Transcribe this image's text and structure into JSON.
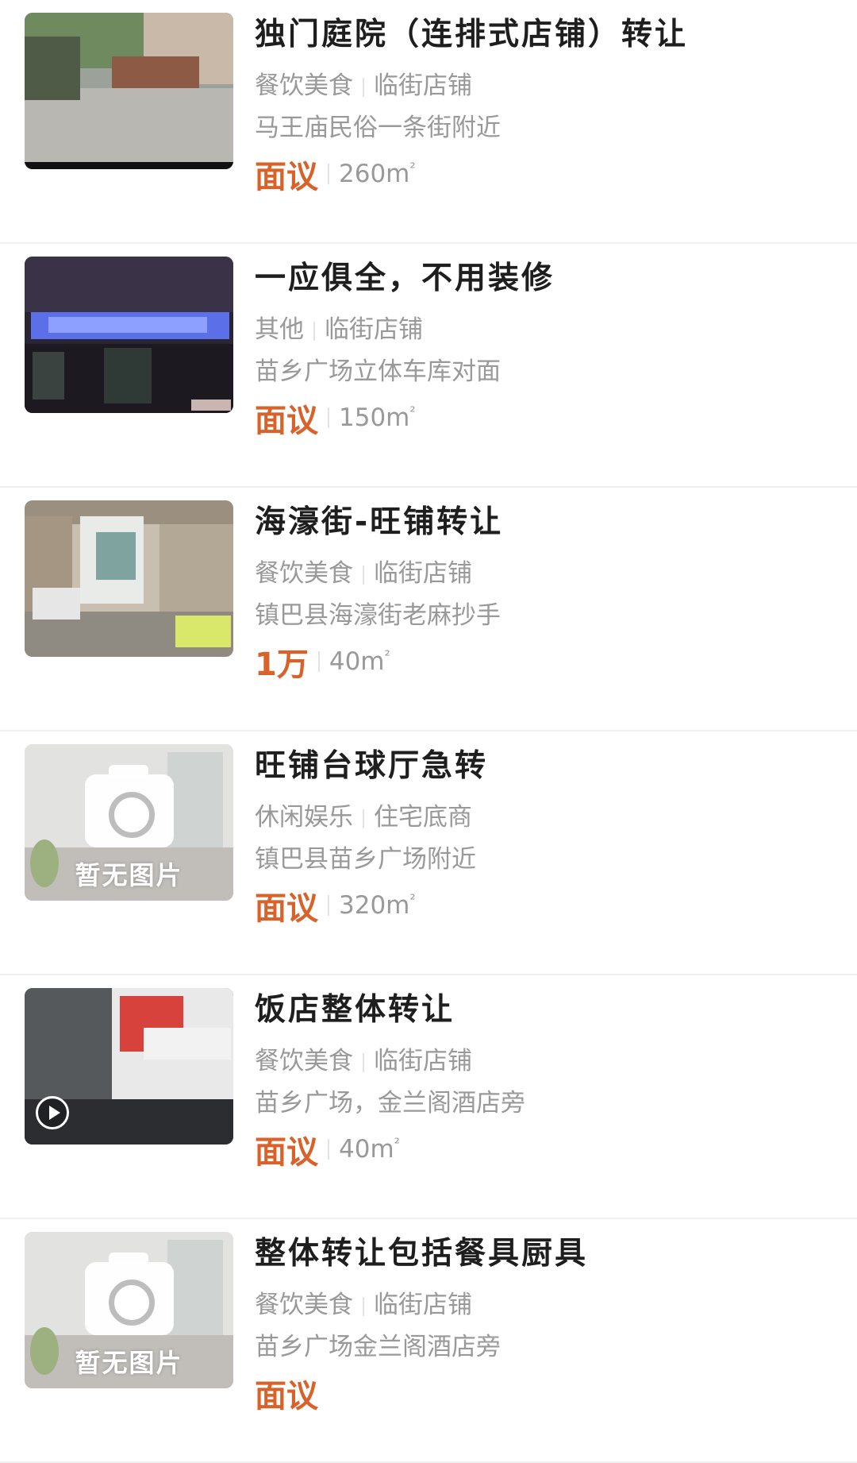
{
  "listings": [
    {
      "title": "独门庭院（连排式店铺）转让",
      "category": "餐饮美食",
      "type": "临街店铺",
      "address": "马王庙民俗一条街附近",
      "price": "面议",
      "area": "260m",
      "area_sup": "²",
      "image": "photo"
    },
    {
      "title": "一应俱全，不用装修",
      "category": "其他",
      "type": "临街店铺",
      "address": "苗乡广场立体车库对面",
      "price": "面议",
      "area": "150m",
      "area_sup": "²",
      "image": "photo"
    },
    {
      "title": "海濠街-旺铺转让",
      "category": "餐饮美食",
      "type": "临街店铺",
      "address": "镇巴县海濠街老麻抄手",
      "price": "1万",
      "area": "40m",
      "area_sup": "²",
      "image": "photo"
    },
    {
      "title": "旺铺台球厅急转",
      "category": "休闲娱乐",
      "type": "住宅底商",
      "address": "镇巴县苗乡广场附近",
      "price": "面议",
      "area": "320m",
      "area_sup": "²",
      "image": "placeholder",
      "placeholder_text": "暂无图片"
    },
    {
      "title": "饭店整体转让",
      "category": "餐饮美食",
      "type": "临街店铺",
      "address": "苗乡广场，金兰阁酒店旁",
      "price": "面议",
      "area": "40m",
      "area_sup": "²",
      "image": "video"
    },
    {
      "title": "整体转让包括餐具厨具",
      "category": "餐饮美食",
      "type": "临街店铺",
      "address": "苗乡广场金兰阁酒店旁",
      "price": "面议",
      "image": "placeholder",
      "placeholder_text": "暂无图片"
    }
  ],
  "colors": {
    "price": "#d9622b",
    "muted": "#999999",
    "title": "#1e1e1e"
  }
}
